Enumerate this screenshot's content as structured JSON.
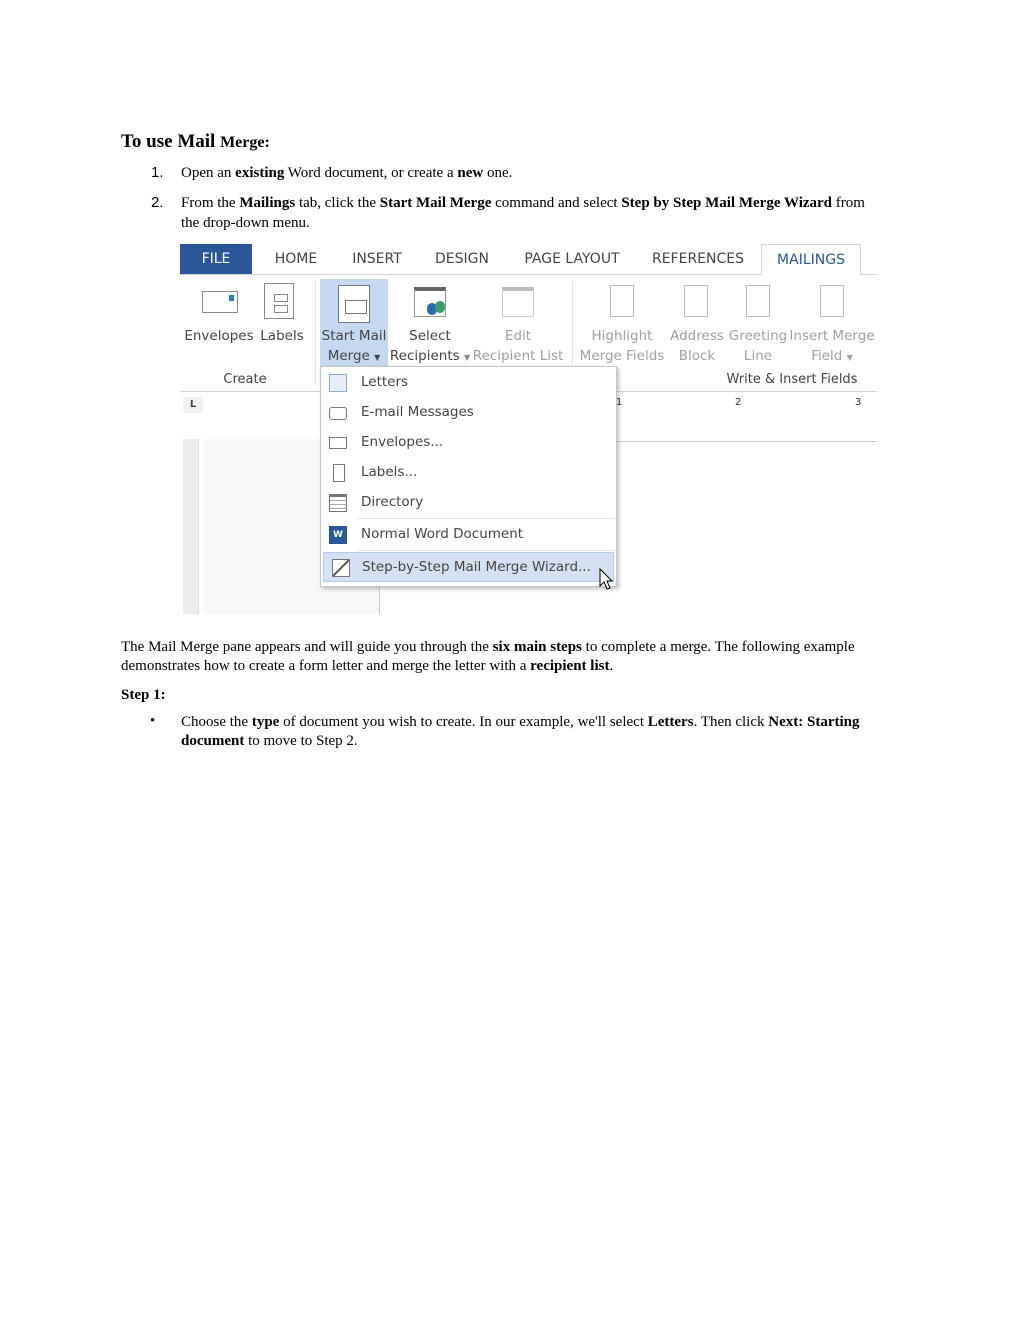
{
  "heading": {
    "part1": "To use Mail",
    "part2": "Merge:"
  },
  "steps": [
    {
      "num": "1.",
      "segments": [
        [
          "Open an ",
          false
        ],
        [
          "existing",
          true
        ],
        [
          " Word document, or create a ",
          false
        ],
        [
          "new",
          true
        ],
        [
          " one.",
          false
        ]
      ]
    },
    {
      "num": "2.",
      "segments": [
        [
          "From the ",
          false
        ],
        [
          "Mailings",
          true
        ],
        [
          " tab, click the ",
          false
        ],
        [
          "Start Mail Merge",
          true
        ],
        [
          " command and select ",
          false
        ],
        [
          "Step by Step Mail Merge Wizard",
          true
        ],
        [
          " from the drop-down menu.",
          false
        ]
      ]
    }
  ],
  "screenshot": {
    "tabs": [
      "FILE",
      "HOME",
      "INSERT",
      "DESIGN",
      "PAGE LAYOUT",
      "REFERENCES",
      "MAILINGS"
    ],
    "active_tab": "MAILINGS",
    "accent": "#2b579a",
    "ribbon": {
      "envelopes": "Envelopes",
      "labels": "Labels",
      "start_mail_merge": [
        "Start Mail",
        "Merge"
      ],
      "select_recipients": [
        "Select",
        "Recipients"
      ],
      "edit_recipient_list": [
        "Edit",
        "Recipient List"
      ],
      "highlight_merge_fields": [
        "Highlight",
        "Merge Fields"
      ],
      "address_block": [
        "Address",
        "Block"
      ],
      "greeting_line": [
        "Greeting",
        "Line"
      ],
      "insert_merge_field": [
        "Insert Merge",
        "Field"
      ],
      "group_create": "Create",
      "group_write_insert": "Write & Insert Fields"
    },
    "ruler": [
      "1",
      "2",
      "3"
    ],
    "menu": [
      {
        "label": "Letters",
        "icon": "letter-icon"
      },
      {
        "label": "E-mail Messages",
        "icon": "email-icon"
      },
      {
        "label": "Envelopes...",
        "icon": "envelope-icon"
      },
      {
        "label": "Labels...",
        "icon": "labels-icon"
      },
      {
        "label": "Directory",
        "icon": "directory-icon"
      },
      {
        "label": "Normal Word Document",
        "icon": "word-icon"
      },
      {
        "label": "Step-by-Step Mail Merge Wizard...",
        "icon": "wizard-icon",
        "highlighted": true
      }
    ]
  },
  "paragraph": [
    [
      "The Mail Merge pane appears and will guide you through the ",
      false
    ],
    [
      "six main steps",
      true
    ],
    [
      " to complete a merge. The following example demonstrates how to create a form letter and merge the letter with a ",
      false
    ],
    [
      "recipient list",
      true
    ],
    [
      ".",
      false
    ]
  ],
  "step1_title": "Step 1:",
  "bullet": [
    [
      "Choose the ",
      false
    ],
    [
      "type",
      true
    ],
    [
      " of document you wish to create. In our example, we'll select ",
      false
    ],
    [
      "Letters",
      true
    ],
    [
      ". Then click ",
      false
    ],
    [
      "Next: Starting document",
      true
    ],
    [
      " to move to Step 2.",
      false
    ]
  ]
}
